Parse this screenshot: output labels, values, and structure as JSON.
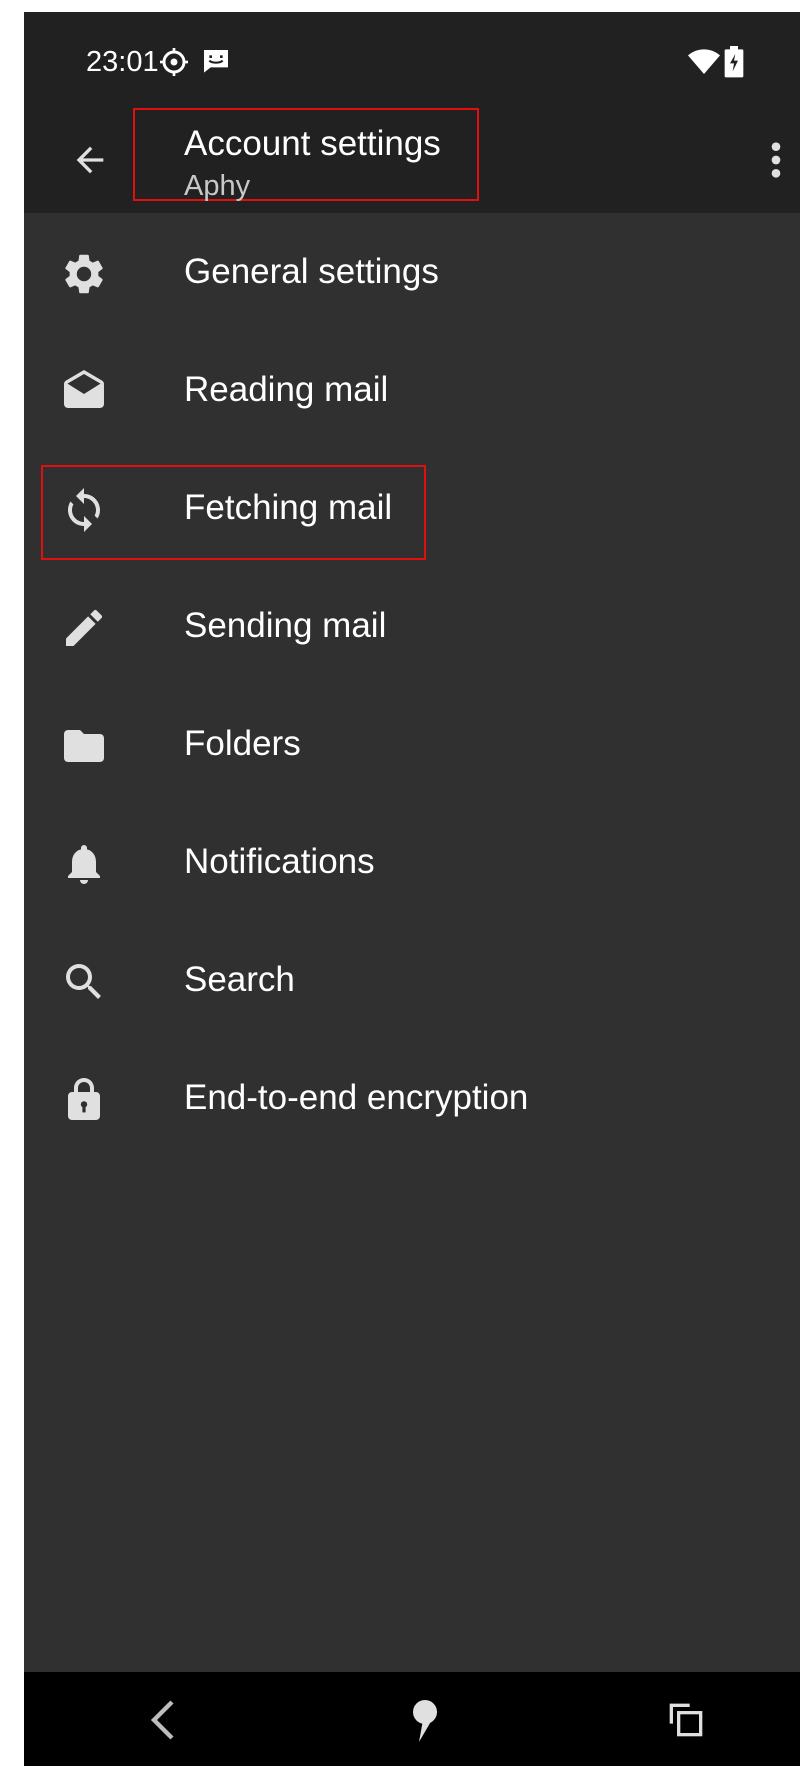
{
  "status_bar": {
    "time": "23:01",
    "left_icons": [
      "settings-gear-status-icon",
      "message-status-icon"
    ],
    "right_icons": [
      "wifi-icon",
      "battery-charging-icon"
    ]
  },
  "app_bar": {
    "title": "Account settings",
    "subtitle": "Aphy",
    "back_icon": "arrow-back-icon",
    "overflow_icon": "more-vert-icon"
  },
  "menu": {
    "items": [
      {
        "label": "General settings",
        "icon": "gear-icon"
      },
      {
        "label": "Reading mail",
        "icon": "envelope-open-icon"
      },
      {
        "label": "Fetching mail",
        "icon": "sync-icon"
      },
      {
        "label": "Sending mail",
        "icon": "pencil-icon"
      },
      {
        "label": "Folders",
        "icon": "folder-icon"
      },
      {
        "label": "Notifications",
        "icon": "bell-icon"
      },
      {
        "label": "Search",
        "icon": "search-icon"
      },
      {
        "label": "End-to-end encryption",
        "icon": "lock-icon"
      }
    ]
  },
  "nav_bar": {
    "icons": [
      "nav-back-icon",
      "nav-home-icon",
      "nav-recents-icon"
    ]
  },
  "colors": {
    "background": "#303030",
    "app_bar": "#212121",
    "nav_bar": "#000000",
    "text": "#ffffff",
    "subtitle_text": "#c8c8c8",
    "icon": "#e0e0e0",
    "highlight": "#e01010"
  }
}
